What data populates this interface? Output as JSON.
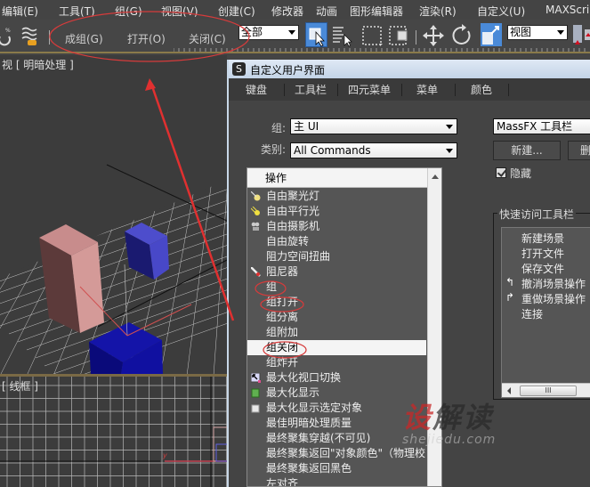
{
  "menubar": {
    "items": [
      "编辑(E)",
      "工具(T)",
      "组(G)",
      "视图(V)",
      "创建(C)",
      "修改器",
      "动画",
      "图形编辑器",
      "渲染(R)",
      "自定义(U)",
      "MAXScri"
    ]
  },
  "toolbar": {
    "group_label": "成组(G)",
    "open_label": "打开(O)",
    "close_label": "关闭(C)",
    "selection_filter": "全部",
    "ref_coord": "视图"
  },
  "viewports": {
    "perspective_label": "视 [ 明暗处理 ]",
    "wireframe_label": "[ 线框 ]"
  },
  "dialog": {
    "title": "自定义用户界面",
    "app_icon": "3ds-max-icon",
    "tabs": [
      "键盘",
      "工具栏",
      "四元菜单",
      "菜单",
      "颜色"
    ],
    "active_tab": "工具栏",
    "group_label": "组:",
    "group_value": "主 UI",
    "category_label": "类别:",
    "category_value": "All Commands",
    "action_list": {
      "header": "操作",
      "items": [
        {
          "label": "自由聚光灯",
          "icon": "spotlight-icon"
        },
        {
          "label": "自由平行光",
          "icon": "direct-light-icon"
        },
        {
          "label": "自由摄影机",
          "icon": "camera-icon"
        },
        {
          "label": "自由旋转",
          "icon": ""
        },
        {
          "label": "阻力空间扭曲",
          "icon": ""
        },
        {
          "label": "阻尼器",
          "icon": "damper-icon"
        },
        {
          "label": "组",
          "icon": ""
        },
        {
          "label": "组打开",
          "icon": ""
        },
        {
          "label": "组分离",
          "icon": ""
        },
        {
          "label": "组附加",
          "icon": ""
        },
        {
          "label": "组关闭",
          "icon": "",
          "selected": true
        },
        {
          "label": "组炸开",
          "icon": ""
        },
        {
          "label": "最大化视口切换",
          "icon": "maximize-viewport-icon"
        },
        {
          "label": "最大化显示",
          "icon": "zoom-extents-icon"
        },
        {
          "label": "最大化显示选定对象",
          "icon": "zoom-extents-selected-icon"
        },
        {
          "label": "最佳明暗处理质量",
          "icon": ""
        },
        {
          "label": "最终聚集穿越(不可见)",
          "icon": ""
        },
        {
          "label": "最终聚集返回\"对象颜色\"（物理校…",
          "icon": ""
        },
        {
          "label": "最终聚集返回黑色",
          "icon": ""
        },
        {
          "label": "左对齐",
          "icon": ""
        }
      ]
    },
    "toolbar_select_value": "MassFX 工具栏",
    "new_button": "新建...",
    "delete_button": "删",
    "hide_checkbox_label": "隐藏",
    "hide_checked": true,
    "quick_access": {
      "legend": "快速访问工具栏",
      "items": [
        {
          "label": "新建场景",
          "icon": ""
        },
        {
          "label": "打开文件",
          "icon": ""
        },
        {
          "label": "保存文件",
          "icon": ""
        },
        {
          "label": "撤消场景操作",
          "icon": "undo-icon"
        },
        {
          "label": "重做场景操作",
          "icon": "redo-icon"
        },
        {
          "label": "连接",
          "icon": ""
        }
      ],
      "scroll_thumb": "III"
    }
  },
  "watermark": {
    "cn_red": "设",
    "cn_dark": "解读",
    "en": "shejiedu.com"
  },
  "colors": {
    "annotation_red": "#d63b3b",
    "ui_bg": "#444444",
    "selection_blue": "#4a90e2"
  }
}
